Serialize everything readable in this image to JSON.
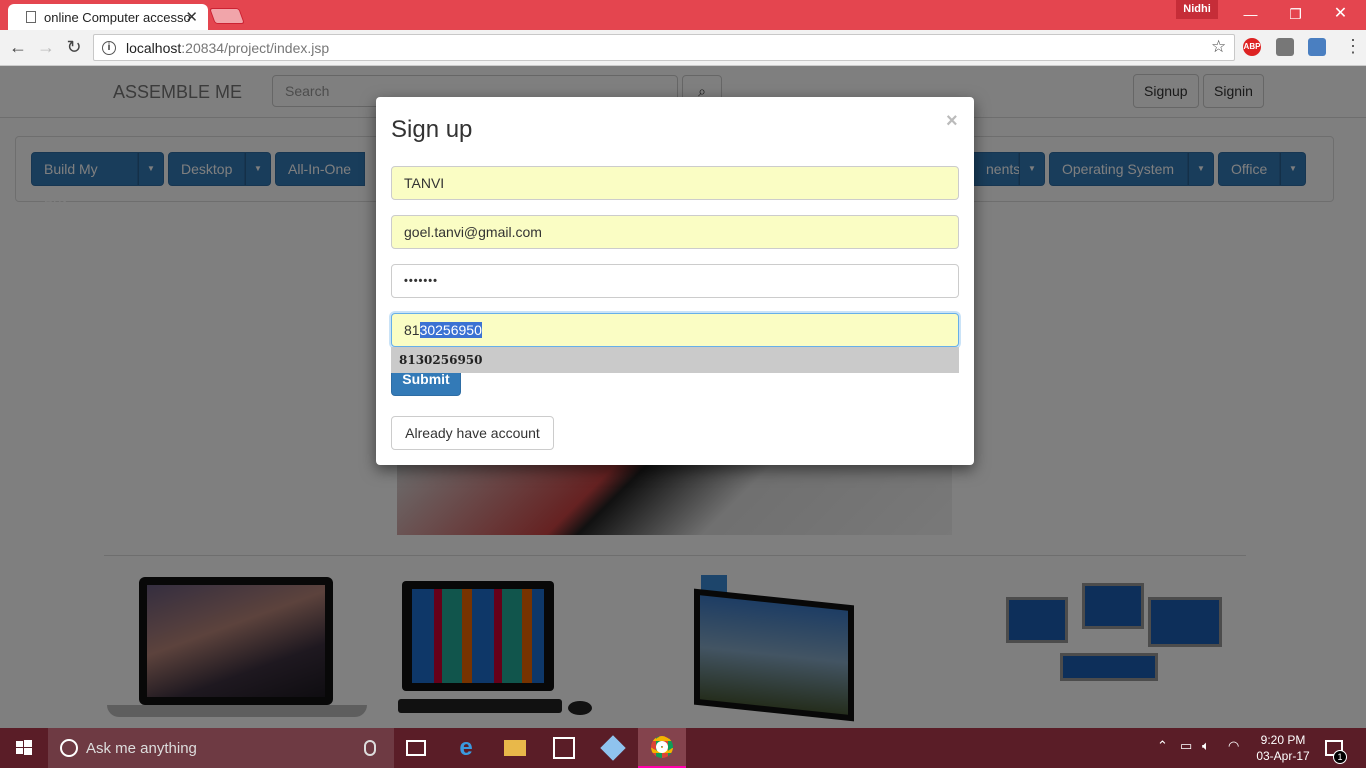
{
  "browser": {
    "tab_title": "online Computer accesso",
    "profile_name": "Nidhi",
    "url_host": "localhost",
    "url_path": ":20834/project/index.jsp",
    "extensions": [
      "ABP"
    ]
  },
  "site": {
    "brand": "ASSEMBLE ME",
    "search_placeholder": "Search",
    "signup_label": "Signup",
    "signin_label": "Signin",
    "menu": [
      {
        "label": "Build My Box"
      },
      {
        "label": "Desktop"
      },
      {
        "label": "All-In-One"
      },
      {
        "label": "nents"
      },
      {
        "label": "Operating System"
      },
      {
        "label": "Office"
      }
    ]
  },
  "modal": {
    "title": "Sign up",
    "close_glyph": "×",
    "name_value": "TANVI",
    "email_value": "goel.tanvi@gmail.com",
    "password_mask": "•••••••",
    "phone_prefix": "81",
    "phone_selected": "30256950",
    "autocomplete_option": "8130256950",
    "submit_label": "Submit",
    "already_label": "Already have account"
  },
  "taskbar": {
    "search_placeholder": "Ask me anything",
    "time": "9:20 PM",
    "date": "03-Apr-17",
    "notification_count": "1"
  },
  "colors": {
    "chrome_red": "#e4454f",
    "primary": "#337ab7",
    "autofill": "#fafdc4",
    "selection": "#3b72d3",
    "taskbar": "#5a1d27"
  }
}
